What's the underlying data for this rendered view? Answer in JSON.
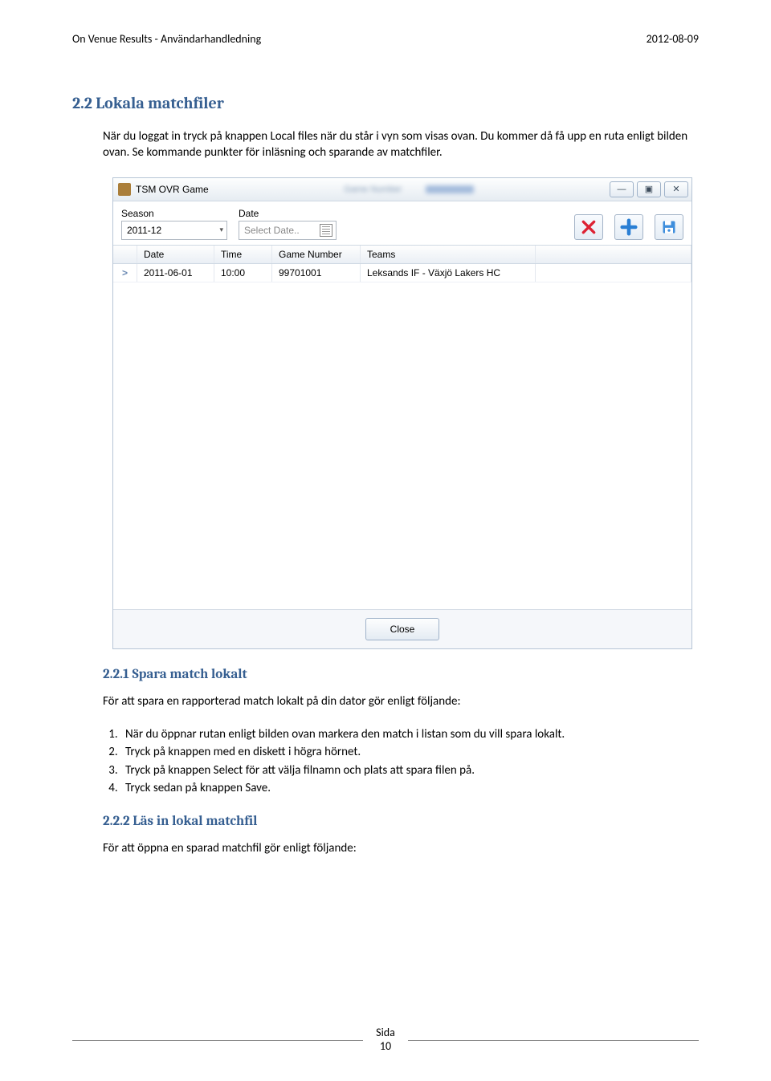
{
  "header": {
    "left": "On Venue Results - Användarhandledning",
    "right": "2012-08-09"
  },
  "section": {
    "num_title": "2.2   Lokala matchfiler",
    "intro": "När du loggat in tryck på knappen Local files när du står i vyn som visas ovan. Du kommer då få upp en ruta enligt bilden ovan. Se kommande punkter för inläsning och sparande av matchfiler."
  },
  "window": {
    "title": "TSM OVR Game",
    "blurred_center": "Game Number",
    "win_controls": {
      "min": "—",
      "max": "▣",
      "close": "✕"
    },
    "fields": {
      "season_label": "Season",
      "season_value": "2011-12",
      "date_label": "Date",
      "date_placeholder": "Select Date.."
    },
    "grid": {
      "headers": {
        "date": "Date",
        "time": "Time",
        "game_number": "Game Number",
        "teams": "Teams"
      },
      "row": {
        "selector": ">",
        "date": "2011-06-01",
        "time": "10:00",
        "game_number": "99701001",
        "teams": "Leksands IF - Växjö Lakers HC"
      }
    },
    "close_label": "Close"
  },
  "subsection1": {
    "num_title": "2.2.1   Spara match lokalt",
    "intro": "För att spara en rapporterad match lokalt på din dator gör enligt följande:",
    "steps": [
      "När du öppnar rutan enligt bilden ovan markera den match i listan som du vill spara lokalt.",
      "Tryck på knappen med en diskett i högra hörnet.",
      "Tryck på knappen Select för att välja filnamn och plats att spara filen på.",
      "Tryck sedan på knappen Save."
    ]
  },
  "subsection2": {
    "num_title": "2.2.2   Läs in lokal matchfil",
    "intro": "För att öppna en sparad matchfil gör enligt följande:"
  },
  "footer": {
    "label": "Sida",
    "page_number": "10"
  }
}
